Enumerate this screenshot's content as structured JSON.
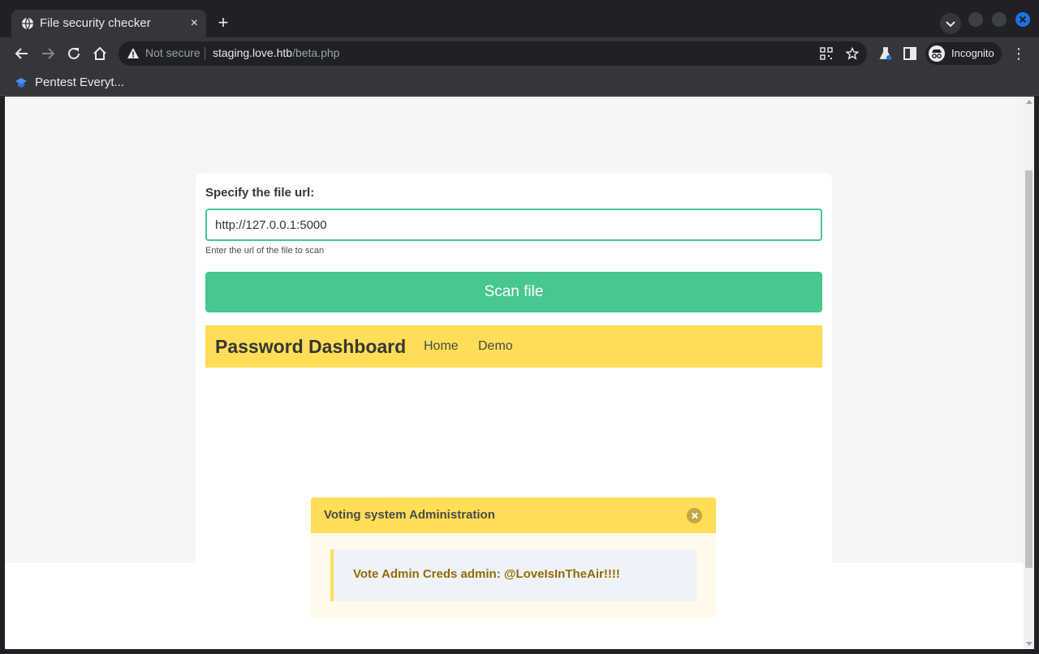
{
  "browser": {
    "tab_title": "File security checker",
    "tab_close": "×",
    "new_tab": "+",
    "security_label": "Not secure",
    "url_host": "staging.love.htb",
    "url_path": "/beta.php",
    "incognito_label": "Incognito",
    "menu_glyph": "⋮",
    "bookmark_label": "Pentest Everyt..."
  },
  "form": {
    "label": "Specify the file url:",
    "url_value": "http://127.0.0.1:5000",
    "help_text": "Enter the url of the file to scan",
    "scan_button": "Scan file"
  },
  "navbar": {
    "brand": "Password Dashboard",
    "links": [
      "Home",
      "Demo"
    ]
  },
  "notification": {
    "title": "Voting system Administration",
    "message": "Vote Admin Creds admin: @LoveIsInTheAir!!!!"
  },
  "colors": {
    "accent_green": "#48c78e",
    "warning_yellow": "#ffdd57",
    "chrome_blue": "#1a73e8"
  }
}
